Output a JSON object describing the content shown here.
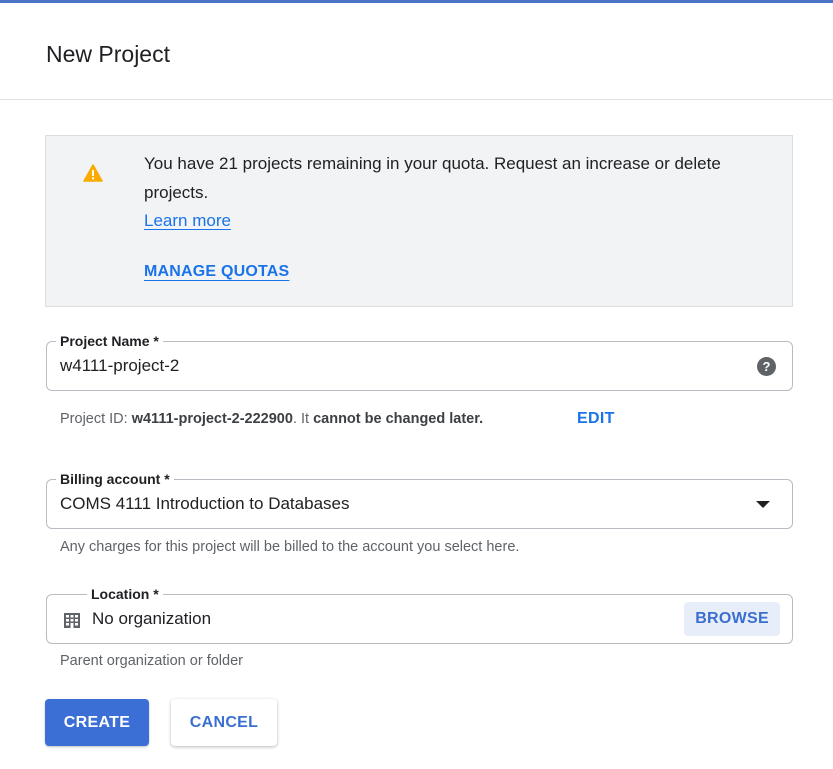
{
  "dialog": {
    "title": "New Project"
  },
  "quota_banner": {
    "icon": "warning-icon",
    "message": "You have 21 projects remaining in your quota. Request an increase or delete projects.",
    "learn_more": "Learn more",
    "manage_quotas": "MANAGE QUOTAS"
  },
  "project_name": {
    "label": "Project Name  *",
    "value": "w4111-project-2",
    "help_icon": "help-icon",
    "help_glyph": "?"
  },
  "project_id": {
    "prefix": "Project ID: ",
    "id": "w4111-project-2-222900",
    "separator": ". It ",
    "suffix": "cannot be changed later.",
    "edit": "EDIT"
  },
  "billing_account": {
    "label": "Billing account  *",
    "value": "COMS 4111 Introduction to Databases",
    "helper": "Any charges for this project will be billed to the account you select here."
  },
  "location": {
    "label": "Location *",
    "icon": "building-icon",
    "value": "No organization",
    "browse": "BROWSE",
    "helper": "Parent organization or folder"
  },
  "actions": {
    "create": "CREATE",
    "cancel": "CANCEL"
  },
  "colors": {
    "accent": "#1a73e8",
    "primary_button": "#3b6fd6",
    "warning": "#f9ab00",
    "banner_bg": "#f1f3f4"
  }
}
